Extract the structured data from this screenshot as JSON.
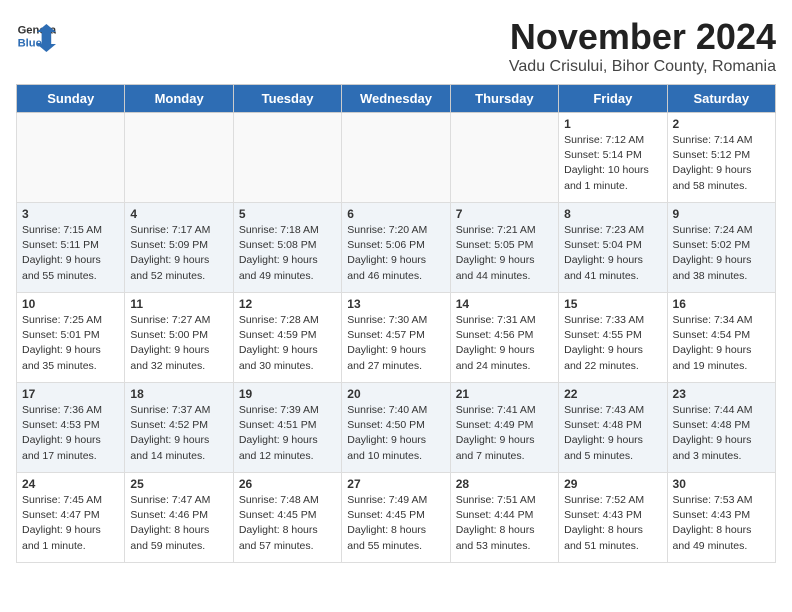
{
  "header": {
    "logo_line1": "General",
    "logo_line2": "Blue",
    "month": "November 2024",
    "location": "Vadu Crisului, Bihor County, Romania"
  },
  "days_of_week": [
    "Sunday",
    "Monday",
    "Tuesday",
    "Wednesday",
    "Thursday",
    "Friday",
    "Saturday"
  ],
  "weeks": [
    [
      {
        "day": "",
        "info": ""
      },
      {
        "day": "",
        "info": ""
      },
      {
        "day": "",
        "info": ""
      },
      {
        "day": "",
        "info": ""
      },
      {
        "day": "",
        "info": ""
      },
      {
        "day": "1",
        "info": "Sunrise: 7:12 AM\nSunset: 5:14 PM\nDaylight: 10 hours and 1 minute."
      },
      {
        "day": "2",
        "info": "Sunrise: 7:14 AM\nSunset: 5:12 PM\nDaylight: 9 hours and 58 minutes."
      }
    ],
    [
      {
        "day": "3",
        "info": "Sunrise: 7:15 AM\nSunset: 5:11 PM\nDaylight: 9 hours and 55 minutes."
      },
      {
        "day": "4",
        "info": "Sunrise: 7:17 AM\nSunset: 5:09 PM\nDaylight: 9 hours and 52 minutes."
      },
      {
        "day": "5",
        "info": "Sunrise: 7:18 AM\nSunset: 5:08 PM\nDaylight: 9 hours and 49 minutes."
      },
      {
        "day": "6",
        "info": "Sunrise: 7:20 AM\nSunset: 5:06 PM\nDaylight: 9 hours and 46 minutes."
      },
      {
        "day": "7",
        "info": "Sunrise: 7:21 AM\nSunset: 5:05 PM\nDaylight: 9 hours and 44 minutes."
      },
      {
        "day": "8",
        "info": "Sunrise: 7:23 AM\nSunset: 5:04 PM\nDaylight: 9 hours and 41 minutes."
      },
      {
        "day": "9",
        "info": "Sunrise: 7:24 AM\nSunset: 5:02 PM\nDaylight: 9 hours and 38 minutes."
      }
    ],
    [
      {
        "day": "10",
        "info": "Sunrise: 7:25 AM\nSunset: 5:01 PM\nDaylight: 9 hours and 35 minutes."
      },
      {
        "day": "11",
        "info": "Sunrise: 7:27 AM\nSunset: 5:00 PM\nDaylight: 9 hours and 32 minutes."
      },
      {
        "day": "12",
        "info": "Sunrise: 7:28 AM\nSunset: 4:59 PM\nDaylight: 9 hours and 30 minutes."
      },
      {
        "day": "13",
        "info": "Sunrise: 7:30 AM\nSunset: 4:57 PM\nDaylight: 9 hours and 27 minutes."
      },
      {
        "day": "14",
        "info": "Sunrise: 7:31 AM\nSunset: 4:56 PM\nDaylight: 9 hours and 24 minutes."
      },
      {
        "day": "15",
        "info": "Sunrise: 7:33 AM\nSunset: 4:55 PM\nDaylight: 9 hours and 22 minutes."
      },
      {
        "day": "16",
        "info": "Sunrise: 7:34 AM\nSunset: 4:54 PM\nDaylight: 9 hours and 19 minutes."
      }
    ],
    [
      {
        "day": "17",
        "info": "Sunrise: 7:36 AM\nSunset: 4:53 PM\nDaylight: 9 hours and 17 minutes."
      },
      {
        "day": "18",
        "info": "Sunrise: 7:37 AM\nSunset: 4:52 PM\nDaylight: 9 hours and 14 minutes."
      },
      {
        "day": "19",
        "info": "Sunrise: 7:39 AM\nSunset: 4:51 PM\nDaylight: 9 hours and 12 minutes."
      },
      {
        "day": "20",
        "info": "Sunrise: 7:40 AM\nSunset: 4:50 PM\nDaylight: 9 hours and 10 minutes."
      },
      {
        "day": "21",
        "info": "Sunrise: 7:41 AM\nSunset: 4:49 PM\nDaylight: 9 hours and 7 minutes."
      },
      {
        "day": "22",
        "info": "Sunrise: 7:43 AM\nSunset: 4:48 PM\nDaylight: 9 hours and 5 minutes."
      },
      {
        "day": "23",
        "info": "Sunrise: 7:44 AM\nSunset: 4:48 PM\nDaylight: 9 hours and 3 minutes."
      }
    ],
    [
      {
        "day": "24",
        "info": "Sunrise: 7:45 AM\nSunset: 4:47 PM\nDaylight: 9 hours and 1 minute."
      },
      {
        "day": "25",
        "info": "Sunrise: 7:47 AM\nSunset: 4:46 PM\nDaylight: 8 hours and 59 minutes."
      },
      {
        "day": "26",
        "info": "Sunrise: 7:48 AM\nSunset: 4:45 PM\nDaylight: 8 hours and 57 minutes."
      },
      {
        "day": "27",
        "info": "Sunrise: 7:49 AM\nSunset: 4:45 PM\nDaylight: 8 hours and 55 minutes."
      },
      {
        "day": "28",
        "info": "Sunrise: 7:51 AM\nSunset: 4:44 PM\nDaylight: 8 hours and 53 minutes."
      },
      {
        "day": "29",
        "info": "Sunrise: 7:52 AM\nSunset: 4:43 PM\nDaylight: 8 hours and 51 minutes."
      },
      {
        "day": "30",
        "info": "Sunrise: 7:53 AM\nSunset: 4:43 PM\nDaylight: 8 hours and 49 minutes."
      }
    ]
  ]
}
